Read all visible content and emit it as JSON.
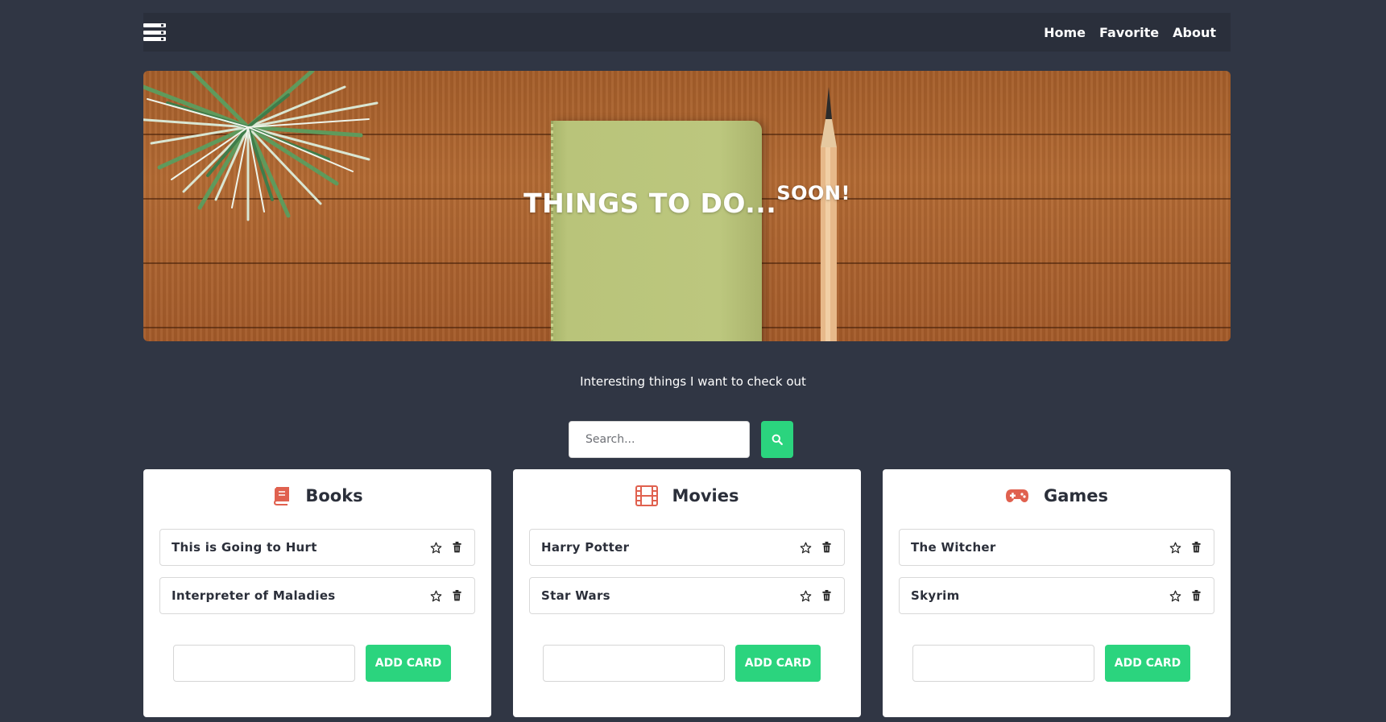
{
  "nav": {
    "links": [
      "Home",
      "Favorite",
      "About"
    ]
  },
  "hero": {
    "title": "THINGS TO DO...",
    "title_sup": "SOON!"
  },
  "subtitle": "Interesting things I want to check out",
  "search": {
    "placeholder": "Search...",
    "icon": "search-icon"
  },
  "columns": [
    {
      "title": "Books",
      "icon": "book-icon",
      "cards": [
        "This is Going to Hurt",
        "Interpreter of Maladies"
      ],
      "add_label": "ADD CARD"
    },
    {
      "title": "Movies",
      "icon": "film-icon",
      "cards": [
        "Harry Potter",
        "Star Wars"
      ],
      "add_label": "ADD CARD"
    },
    {
      "title": "Games",
      "icon": "gamepad-icon",
      "cards": [
        "The Witcher",
        "Skyrim"
      ],
      "add_label": "ADD CARD"
    }
  ],
  "colors": {
    "background": "#303644",
    "navbar": "#2a2f3b",
    "accent": "#2bd47e",
    "icon_red": "#e0614f",
    "card_bg": "#ffffff"
  }
}
